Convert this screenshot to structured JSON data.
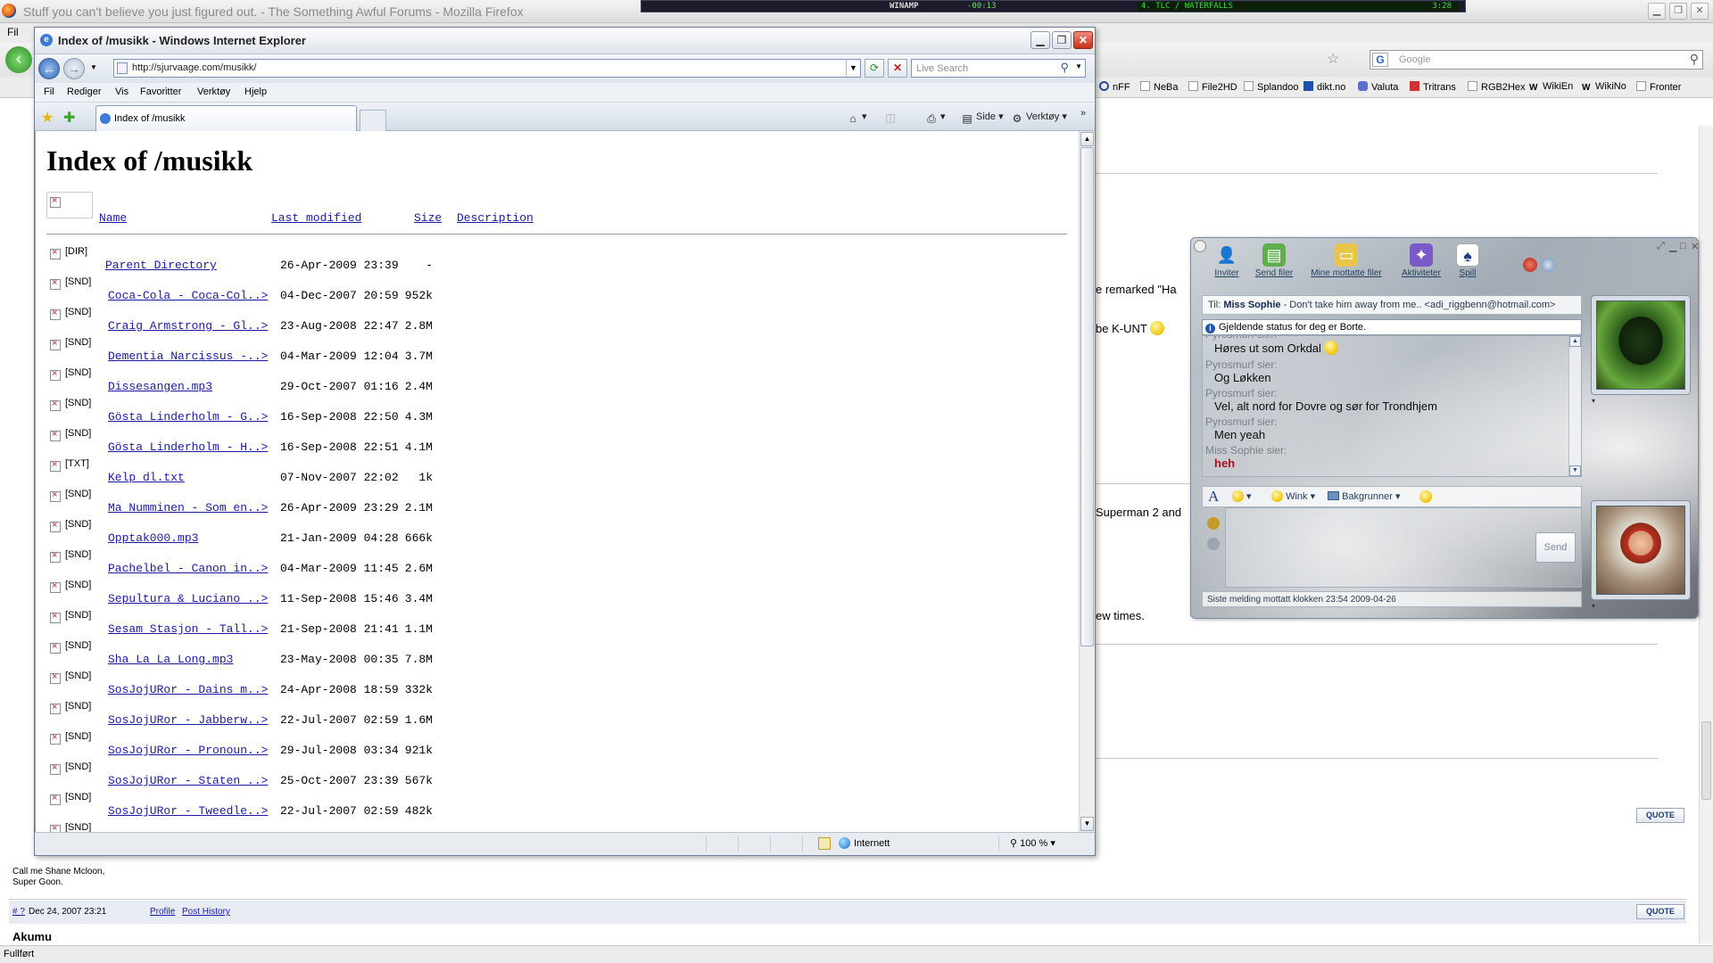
{
  "firefox": {
    "title": "Stuff you can't believe you just figured out. - The Something Awful Forums - Mozilla Firefox",
    "menu_first": "Fil",
    "search_placeholder": "Google",
    "bookmarks": [
      "nFF",
      "NeBa",
      "File2HD",
      "Splandoo",
      "dikt.no",
      "Valuta",
      "Tritrans",
      "RGB2Hex",
      "WikiEn",
      "WikiNo",
      "Fronter"
    ],
    "forum": {
      "snippet1": "e remarked \"Ha",
      "snippet2": "be K-UNT",
      "snippet3": "Superman 2 and",
      "snippet4": "ew times.",
      "sig_line1": "Call me Shane Mcloon,",
      "sig_line2": "Super Goon.",
      "post_id": "# ?",
      "post_date": "Dec 24, 2007 23:21",
      "profile": "Profile",
      "post_history": "Post History",
      "author": "Akumu",
      "quote_label": "QUOTE"
    },
    "status": "Fullført"
  },
  "winamp": {
    "label": "WINAMP",
    "time": "-00:13",
    "track": "4. TLC / WATERFALLS",
    "track_time": "3:28"
  },
  "ie": {
    "title": "Index of /musikk - Windows Internet Explorer",
    "url": "http://sjurvaage.com/musikk/",
    "search_placeholder": "Live Search",
    "menu": [
      "Fil",
      "Rediger",
      "Vis",
      "Favoritter",
      "Verktøy",
      "Hjelp"
    ],
    "tab_label": "Index of /musikk",
    "cmd_page": "Side",
    "cmd_tools": "Verktøy",
    "zone": "Internett",
    "zoom": "100 %",
    "chevron": "»"
  },
  "listing": {
    "heading": "Index of /musikk",
    "columns": {
      "name": "Name",
      "modified": "Last modified",
      "size": "Size",
      "description": "Description"
    },
    "rows": [
      {
        "type": "[DIR]",
        "name": "Parent Directory",
        "modified": "26-Apr-2009 23:39",
        "size": "-"
      },
      {
        "type": "[SND]",
        "name": "Coca-Cola - Coca-Col..>",
        "modified": "04-Dec-2007 20:59",
        "size": "952k"
      },
      {
        "type": "[SND]",
        "name": "Craig Armstrong - Gl..>",
        "modified": "23-Aug-2008 22:47",
        "size": "2.8M"
      },
      {
        "type": "[SND]",
        "name": "Dementia Narcissus -..>",
        "modified": "04-Mar-2009 12:04",
        "size": "3.7M"
      },
      {
        "type": "[SND]",
        "name": "Dissesangen.mp3",
        "modified": "29-Oct-2007 01:16",
        "size": "2.4M"
      },
      {
        "type": "[SND]",
        "name": "Gösta Linderholm - G..>",
        "modified": "16-Sep-2008 22:50",
        "size": "4.3M"
      },
      {
        "type": "[SND]",
        "name": "Gösta Linderholm - H..>",
        "modified": "16-Sep-2008 22:51",
        "size": "4.1M"
      },
      {
        "type": "[TXT]",
        "name": "Kelp_dl.txt",
        "modified": "07-Nov-2007 22:02",
        "size": "1k"
      },
      {
        "type": "[SND]",
        "name": "Ma Numminen - Som en..>",
        "modified": "26-Apr-2009 23:29",
        "size": "2.1M"
      },
      {
        "type": "[SND]",
        "name": "Opptak000.mp3",
        "modified": "21-Jan-2009 04:28",
        "size": "666k"
      },
      {
        "type": "[SND]",
        "name": "Pachelbel - Canon in..>",
        "modified": "04-Mar-2009 11:45",
        "size": "2.6M"
      },
      {
        "type": "[SND]",
        "name": "Sepultura & Luciano ..>",
        "modified": "11-Sep-2008 15:46",
        "size": "3.4M"
      },
      {
        "type": "[SND]",
        "name": "Sesam Stasjon - Tall..>",
        "modified": "21-Sep-2008 21:41",
        "size": "1.1M"
      },
      {
        "type": "[SND]",
        "name": "Sha La La Long.mp3",
        "modified": "23-May-2008 00:35",
        "size": "7.8M"
      },
      {
        "type": "[SND]",
        "name": "SosJojURor - Dains m..>",
        "modified": "24-Apr-2008 18:59",
        "size": "332k"
      },
      {
        "type": "[SND]",
        "name": "SosJojURor - Jabberw..>",
        "modified": "22-Jul-2007 02:59",
        "size": "1.6M"
      },
      {
        "type": "[SND]",
        "name": "SosJojURor - Pronoun..>",
        "modified": "29-Jul-2008 03:34",
        "size": "921k"
      },
      {
        "type": "[SND]",
        "name": "SosJojURor - Staten ..>",
        "modified": "25-Oct-2007 23:39",
        "size": "567k"
      },
      {
        "type": "[SND]",
        "name": "SosJojURor - Tweedle..>",
        "modified": "22-Jul-2007 02:59",
        "size": "482k"
      },
      {
        "type": "[SND]",
        "name": "",
        "modified": "",
        "size": ""
      }
    ]
  },
  "msn": {
    "toolbar": [
      "Inviter",
      "Send filer",
      "Mine mottatte filer",
      "Aktiviteter",
      "Spill"
    ],
    "to_label": "Til:",
    "to_name": "Miss Sophie",
    "to_rest": "- Don't take him away from me.. <adi_riggbenn@hotmail.com>",
    "status_text": "Gjeldende status for deg er Borte.",
    "messages": [
      {
        "kind": "sender",
        "text": "Pyrosmurf sier:"
      },
      {
        "kind": "text",
        "text": "Høres ut som Orkdal"
      },
      {
        "kind": "sender",
        "text": "Pyrosmurf sier:"
      },
      {
        "kind": "text",
        "text": "Og Løkken"
      },
      {
        "kind": "sender",
        "text": "Pyrosmurf sier:"
      },
      {
        "kind": "text",
        "text": "Vel, alt nord for Dovre og sør for Trondhjem"
      },
      {
        "kind": "sender",
        "text": "Pyrosmurf sier:"
      },
      {
        "kind": "text",
        "text": "Men yeah"
      },
      {
        "kind": "sender",
        "text": "Miss Sophie sier:"
      },
      {
        "kind": "red",
        "text": "heh"
      }
    ],
    "font_btn": "A",
    "wink": "Wink",
    "backgrounds": "Bakgrunner",
    "send": "Send",
    "footer": "Siste melding mottatt klokken 23:54 2009-04-26"
  },
  "colors": {
    "link": "#1a1aa6",
    "ie_frame": "#6c7d95",
    "msn_red": "#b0101c"
  }
}
